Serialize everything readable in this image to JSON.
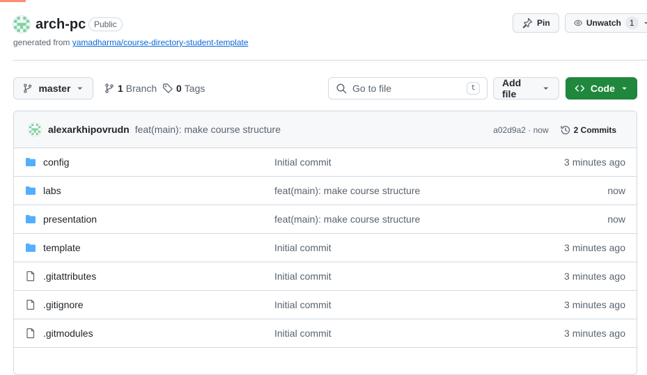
{
  "colors": {
    "accent_green": "#1f883d",
    "link_blue": "#0969da",
    "folder_blue": "#54aeff",
    "muted_text": "#59636e",
    "border": "#d1d9e0"
  },
  "header": {
    "repo_name": "arch-pc",
    "visibility_badge": "Public",
    "generated_prefix": "generated from",
    "template_link": "yamadharma/course-directory-student-template",
    "avatar_icon": "identicon-avatar"
  },
  "actions": {
    "pin_label": "Pin",
    "pin_icon": "pin-icon",
    "unwatch_label": "Unwatch",
    "unwatch_icon": "eye-icon",
    "unwatch_count": "1"
  },
  "toolbar": {
    "branch_label": "master",
    "branch_icon": "git-branch-icon",
    "branches_count": "1",
    "branches_label": "Branch",
    "tags_count": "0",
    "tags_label": "Tags",
    "search_placeholder": "Go to file",
    "search_shortcut": "t",
    "add_file_label": "Add file",
    "code_label": "Code"
  },
  "latest_commit": {
    "author": "alexarkhipovrudn",
    "message": "feat(main): make course structure",
    "sha": "a02d9a2 · now",
    "commits_count_label": "2 Commits"
  },
  "files": [
    {
      "name": "config",
      "type": "folder",
      "message": "Initial commit",
      "age": "3 minutes ago"
    },
    {
      "name": "labs",
      "type": "folder",
      "message": "feat(main): make course structure",
      "age": "now"
    },
    {
      "name": "presentation",
      "type": "folder",
      "message": "feat(main): make course structure",
      "age": "now"
    },
    {
      "name": "template",
      "type": "folder",
      "message": "Initial commit",
      "age": "3 minutes ago"
    },
    {
      "name": ".gitattributes",
      "type": "file",
      "message": "Initial commit",
      "age": "3 minutes ago"
    },
    {
      "name": ".gitignore",
      "type": "file",
      "message": "Initial commit",
      "age": "3 minutes ago"
    },
    {
      "name": ".gitmodules",
      "type": "file",
      "message": "Initial commit",
      "age": "3 minutes ago"
    }
  ]
}
